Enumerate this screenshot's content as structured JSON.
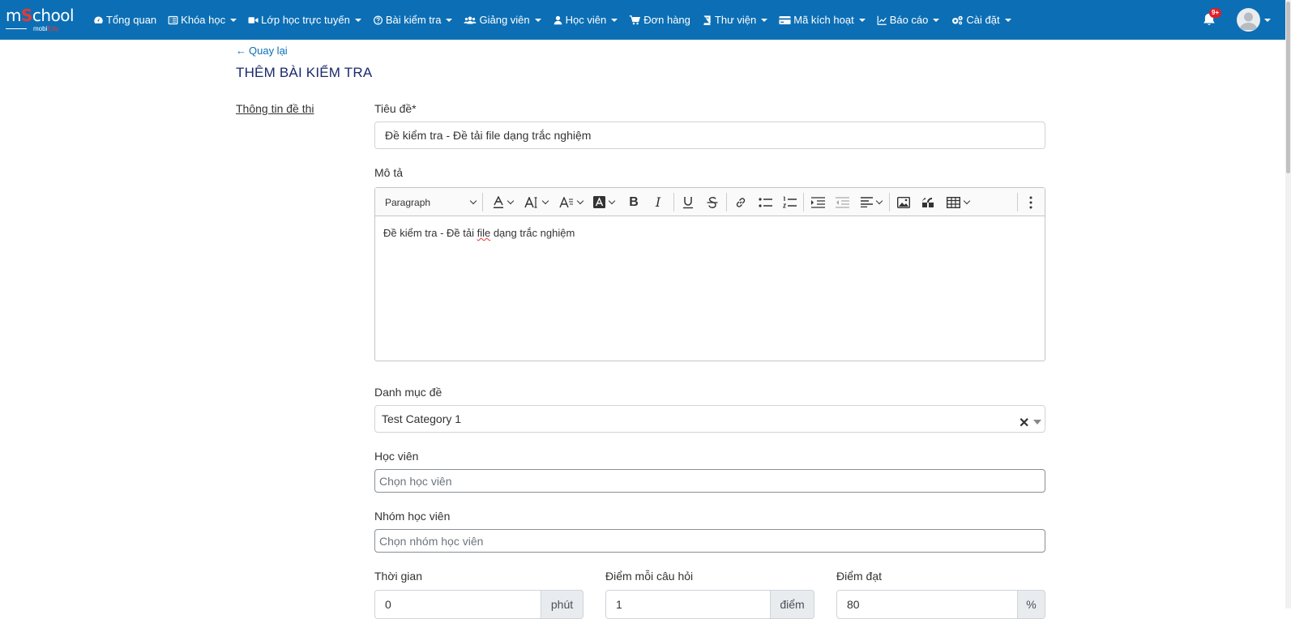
{
  "nav": {
    "logo_main": "mSchool",
    "logo_sub": "mobiEdu",
    "items": [
      {
        "label": "Tổng quan",
        "icon": "dashboard-icon",
        "dropdown": false
      },
      {
        "label": "Khóa học",
        "icon": "list-icon",
        "dropdown": true
      },
      {
        "label": "Lớp học trực tuyến",
        "icon": "video-icon",
        "dropdown": true
      },
      {
        "label": "Bài kiểm tra",
        "icon": "question-circle-icon",
        "dropdown": true
      },
      {
        "label": "Giảng viên",
        "icon": "users-icon",
        "dropdown": true
      },
      {
        "label": "Học viên",
        "icon": "user-icon",
        "dropdown": true
      },
      {
        "label": "Đơn hàng",
        "icon": "cart-icon",
        "dropdown": false
      },
      {
        "label": "Thư viện",
        "icon": "book-icon",
        "dropdown": true
      },
      {
        "label": "Mã kích hoạt",
        "icon": "credit-card-icon",
        "dropdown": true
      },
      {
        "label": "Báo cáo",
        "icon": "chart-line-icon",
        "dropdown": true
      },
      {
        "label": "Cài đặt",
        "icon": "cogs-icon",
        "dropdown": true
      }
    ],
    "notification_badge": "9+"
  },
  "page": {
    "back_label": "Quay lại",
    "title": "THÊM BÀI KIỂM TRA",
    "section_label": "Thông tin đề thi"
  },
  "form": {
    "title_label": "Tiêu đề*",
    "title_value": "Đề kiểm tra - Đề tải file dạng trắc nghiệm",
    "description_label": "Mô tả",
    "editor": {
      "paragraph_style": "Paragraph",
      "content_before": "Đề kiểm tra - Đề tải ",
      "content_misspelled": "file",
      "content_after": " dạng trắc nghiệm"
    },
    "category_label": "Danh mục đề",
    "category_value": "Test Category 1",
    "students_label": "Học viên",
    "students_placeholder": "Chọn học viên",
    "student_groups_label": "Nhóm học viên",
    "student_groups_placeholder": "Chọn nhóm học viên",
    "time_label": "Thời gian",
    "time_value": "0",
    "time_unit": "phút",
    "points_per_question_label": "Điểm mỗi câu hỏi",
    "points_per_question_value": "1",
    "points_unit": "điểm",
    "pass_score_label": "Điểm đạt",
    "pass_score_value": "80",
    "pass_score_unit": "%"
  },
  "colors": {
    "navbar": "#0c6fb5",
    "title": "#1a2a6c",
    "link": "#0c6fb5",
    "badge": "#e21f26"
  }
}
